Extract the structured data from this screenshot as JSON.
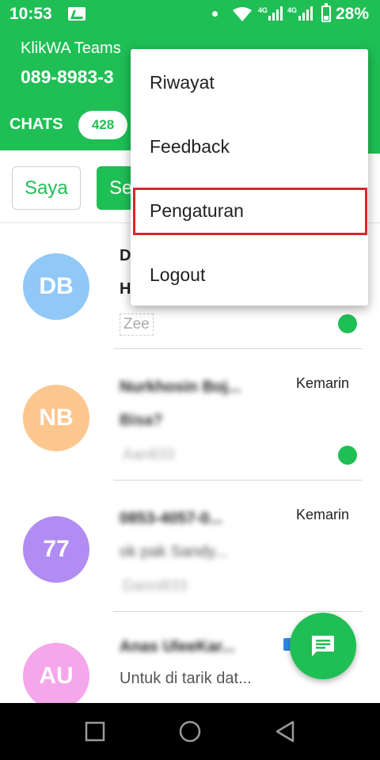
{
  "status_bar": {
    "time": "10:53",
    "network_label": "4G",
    "battery_percent": "28%"
  },
  "header": {
    "account_name": "KlikWA Teams",
    "account_phone": "089-8983-3",
    "tab_label": "CHATS",
    "tab_badge": "428"
  },
  "filters": {
    "saya_label": "Saya",
    "second_label": "Se"
  },
  "chats": [
    {
      "initials": "DB",
      "avatar_color": "#90c8f8",
      "name": "D",
      "preview": "H",
      "agent": "Zee",
      "time": "",
      "online": true
    },
    {
      "initials": "NB",
      "avatar_color": "#fcc78e",
      "name": "Nurkhosin Boj...",
      "preview": "Bisa?",
      "agent": "Aan833",
      "time": "Kemarin",
      "online": true
    },
    {
      "initials": "77",
      "avatar_color": "#b18cf3",
      "name": "0853-4057-0...",
      "preview": "ok pak Sandy...",
      "agent": "Danni833",
      "time": "Kemarin",
      "online": false
    },
    {
      "initials": "AU",
      "avatar_color": "#f6a6ea",
      "name": "Anas UleeKar...",
      "preview": "Untuk di tarik dat...",
      "agent": "",
      "time": "",
      "online": false
    }
  ],
  "menu": {
    "items": [
      "Riwayat",
      "Feedback",
      "Pengaturan",
      "Logout"
    ],
    "highlighted": "Pengaturan",
    "highlight_color": "#d8262c"
  },
  "colors": {
    "primary": "#1fbf55"
  },
  "icons": {
    "fab": "new-message-icon",
    "nav": [
      "recent-apps-icon",
      "home-icon",
      "back-icon"
    ]
  }
}
